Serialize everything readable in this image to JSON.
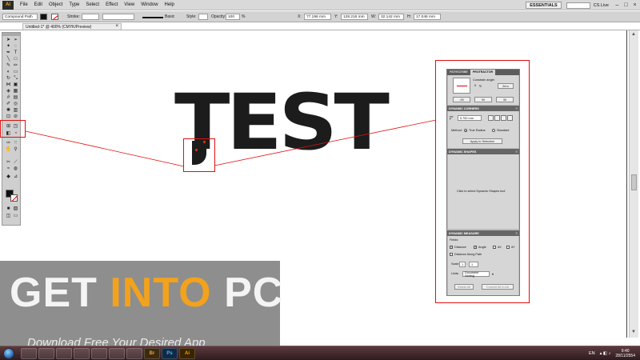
{
  "menubar": {
    "app_logo": "Ai",
    "items": [
      "File",
      "Edit",
      "Object",
      "Type",
      "Select",
      "Effect",
      "View",
      "Window",
      "Help"
    ],
    "workspace": "ESSENTIALS",
    "cs_live": "CS Live",
    "window_controls": [
      "–",
      "□",
      "×"
    ]
  },
  "controlbar": {
    "selection": "Compound Path",
    "stroke_label": "Stroke:",
    "stroke_style": "Basic",
    "style_label": "Style:",
    "opacity_label": "Opacity:",
    "opacity_value": "100",
    "opacity_unit": "%",
    "x_label": "X:",
    "x_value": "77.196 mm",
    "y_label": "Y:",
    "y_value": "128.216 mm",
    "w_label": "W:",
    "w_value": "32.142 mm",
    "h_label": "H:",
    "h_value": "17.046 mm"
  },
  "document_tab": {
    "title": "Untitled-1* @ 400% (CMYK/Preview)",
    "close": "×"
  },
  "artwork": {
    "text": "TEST"
  },
  "panels": {
    "tabs": [
      "PATHSCRIBE",
      "PROTRACTOR"
    ],
    "protractor": {
      "constrain_label": "Constrain angle:",
      "constrain_value": "0",
      "zero_button": "Zero",
      "buttons": [
        "-90",
        "90",
        "30"
      ]
    },
    "dynamic_corners": {
      "header": "DYNAMIC CORNERS",
      "radius": "5.752 mm",
      "method_label": "Method:",
      "true_radius": "True Radius",
      "standard": "Standard",
      "apply_button": "Apply to Selection"
    },
    "dynamic_shapes": {
      "header": "DYNAMIC SHAPES",
      "message": "Click to select Dynamic Shapes tool"
    },
    "dynamic_measure": {
      "header": "DYNAMIC MEASURE",
      "fields_label": "Fields:",
      "distance": "Distance",
      "angle": "Angle",
      "dx": "dX",
      "dy": "dY",
      "along_path": "Distance Along Path",
      "scale_label": "Scale:",
      "scale_a": "1",
      "scale_sep": ":",
      "scale_b": "1",
      "units_label": "Units:",
      "units_value": "Document Setting",
      "delete_all": "Delete All",
      "convert_all": "Convert All to Art"
    }
  },
  "watermark": {
    "get": "GET ",
    "into": "INTO",
    "pc": " PC",
    "subtitle": "Download Free Your Desired App"
  },
  "taskbar": {
    "apps": [
      "",
      "",
      "",
      "",
      "",
      "",
      "",
      "Br",
      "Ps",
      "Ai"
    ],
    "language": "EN",
    "time": "9:40",
    "date": "28/11/2554"
  },
  "colors": {
    "callout": "#e01010",
    "anchor": "#e63a00",
    "watermark_accent": "#f3a21b"
  }
}
